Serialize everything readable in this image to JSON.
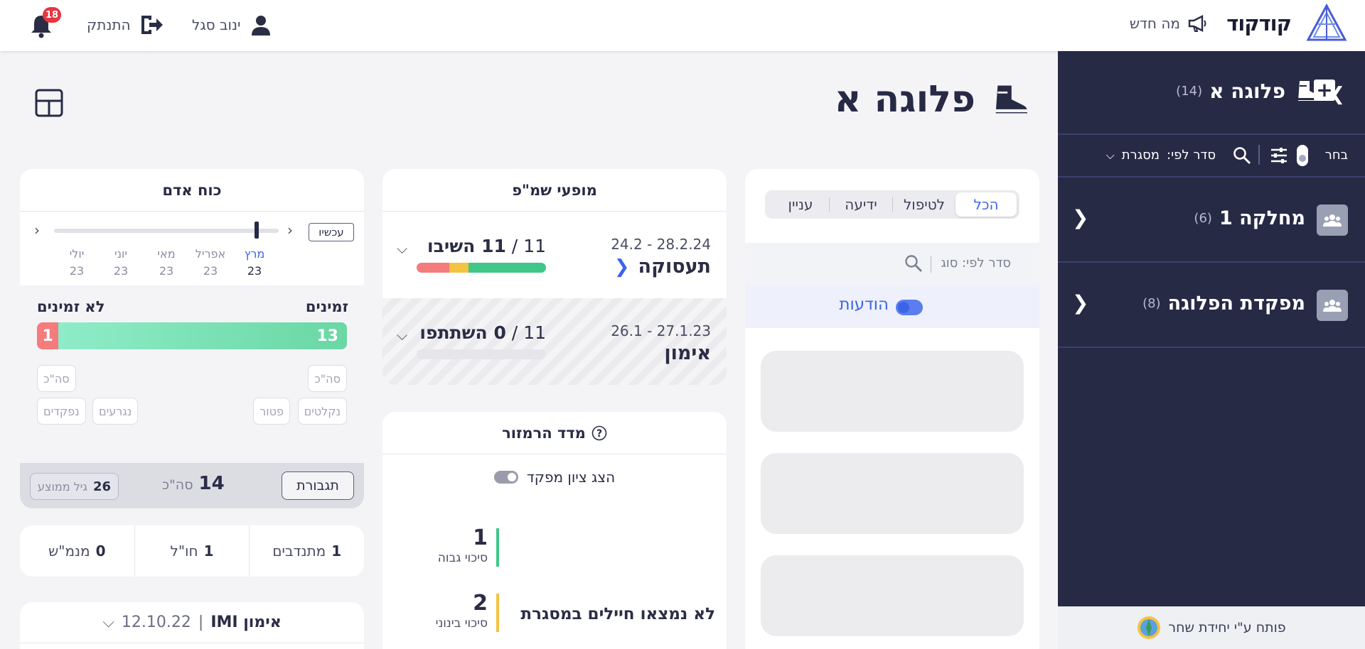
{
  "topbar": {
    "brand": "קודקוד",
    "whats_new": "מה חדש",
    "user_name": "ינוב סגל",
    "logout": "התנתק",
    "notifications_count": "18"
  },
  "sidebar": {
    "title": "פלוגה א",
    "title_count": "(14)",
    "select_label": "בחר",
    "sort_label": "סדר לפי:",
    "sort_value": "מסגרת",
    "items": [
      {
        "label": "מחלקה 1",
        "count": "(6)"
      },
      {
        "label": "מפקדת הפלוגה",
        "count": "(8)"
      }
    ],
    "footer": "פותח ע\"י יחידת שחר"
  },
  "page": {
    "title": "פלוגה א"
  },
  "alerts_card": {
    "tabs": [
      "הכל",
      "לטיפול",
      "ידיעה",
      "עניין"
    ],
    "active_tab": "הכל",
    "sort_label": "סדר לפי: סוג",
    "notifications_toggle": "הודעות"
  },
  "events_card": {
    "title": "מופעי שמ\"פ",
    "events": [
      {
        "dates": "28.2.24 - 24.2",
        "name": "תעסוקה",
        "total": "11",
        "count_label": "11 השיבו",
        "bar": [
          {
            "color": "#3ec787",
            "value": 0.6
          },
          {
            "color": "#f3c341",
            "value": 0.15
          },
          {
            "color": "#f47c7c",
            "value": 0.25
          }
        ]
      },
      {
        "dates": "27.1.23 - 26.1",
        "name": "אימון",
        "total": "11",
        "count_label": "0 השתתפו",
        "bar": []
      }
    ]
  },
  "retention_card": {
    "title": "מדד הרמזור",
    "show_toggle": "הצג ציון מפקד",
    "risks": [
      {
        "value": "1",
        "label": "סיכוי גבוה",
        "color": "#3ec787"
      },
      {
        "value": "2",
        "label": "סיכוי בינוני",
        "color": "#f3c341"
      }
    ],
    "no_soldiers": "לא נמצאו חיילים במסגרת"
  },
  "manpower_card": {
    "title": "כוח אדם",
    "now_button": "עכשיו",
    "months": [
      {
        "name": "מרץ",
        "year": "23",
        "selected": true
      },
      {
        "name": "אפריל",
        "year": "23",
        "selected": false
      },
      {
        "name": "מאי",
        "year": "23",
        "selected": false
      },
      {
        "name": "יוני",
        "year": "23",
        "selected": false
      },
      {
        "name": "יולי",
        "year": "23",
        "selected": false
      }
    ],
    "available_label": "זמינים",
    "unavailable_label": "לא זמינים",
    "available_count": "13",
    "unavailable_count": "1",
    "chips": {
      "total_right": "סה\"כ",
      "total_left": "סה\"כ",
      "absorbed": "נקלטים",
      "exempt": "פטור",
      "dropped": "נגרעים",
      "discharged": "נפקדים"
    },
    "reinforcements_button": "תגבורת",
    "total_value": "14",
    "total_label": "סה\"כ",
    "avg_age_value": "26",
    "avg_age_label": "גיל ממוצע"
  },
  "stats_card": [
    {
      "value": "1",
      "label": "מתנדבים"
    },
    {
      "value": "1",
      "label": "חו\"ל"
    },
    {
      "value": "0",
      "label": "מנמ\"ש"
    }
  ],
  "training_card": {
    "title": "אימון IMI",
    "date": "12.10.22"
  }
}
